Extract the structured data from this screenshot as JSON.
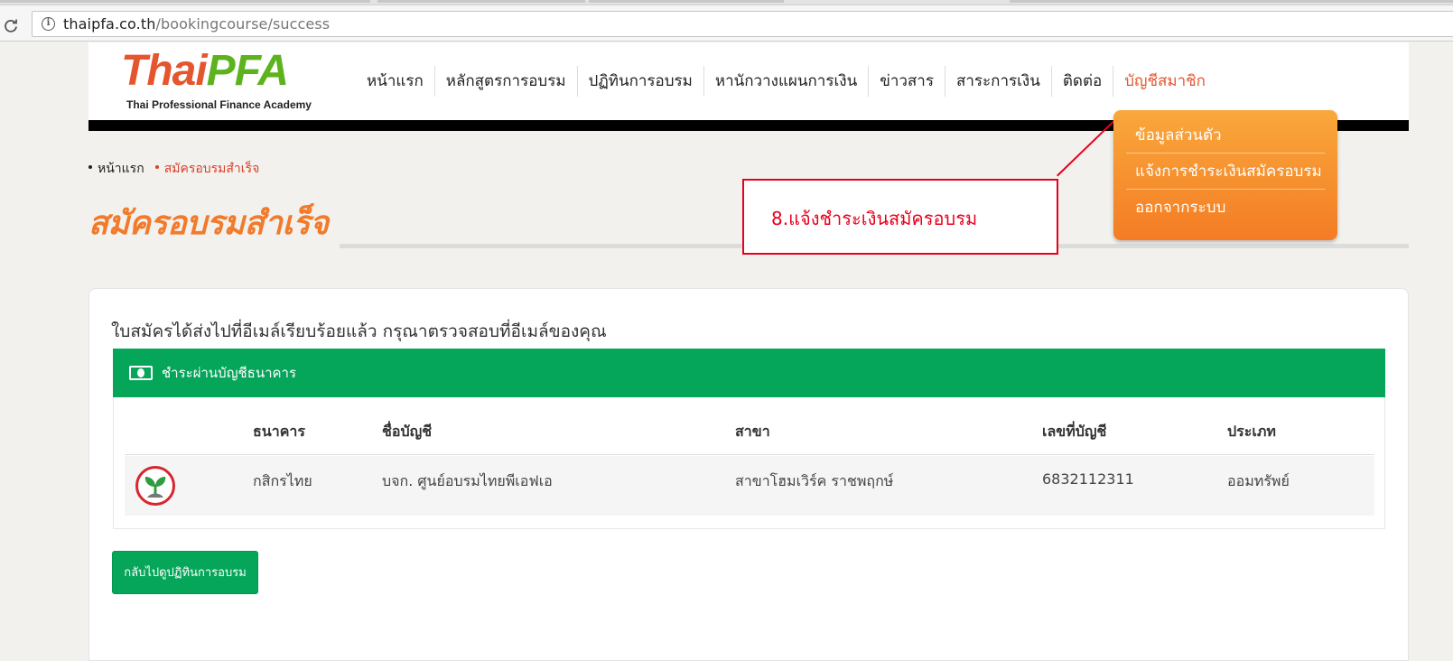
{
  "browser": {
    "url_host": "thaipfa.co.th",
    "url_path": "/bookingcourse/success"
  },
  "logo": {
    "name_part1": "Thai",
    "name_part2": "PFA",
    "tagline": "Thai Professional Finance Academy"
  },
  "nav": {
    "items": [
      "หน้าแรก",
      "หลักสูตรการอบรม",
      "ปฏิทินการอบรม",
      "หานักวางแผนการเงิน",
      "ข่าวสาร",
      "สาระการเงิน",
      "ติดต่อ"
    ],
    "active_item": "บัญชีสมาชิก"
  },
  "account_menu": {
    "items": [
      "ข้อมูลส่วนตัว",
      "แจ้งการชำระเงินสมัครอบรม",
      "ออกจากระบบ"
    ]
  },
  "breadcrumb": {
    "home": "หน้าแรก",
    "current": "สมัครอบรมสำเร็จ"
  },
  "page_title": "สมัครอบรมสำเร็จ",
  "annotation": {
    "text": "8.แจ้งชำระเงินสมัครอบรม",
    "color": "#e8001c"
  },
  "content": {
    "intro": "ใบสมัครได้ส่งไปที่อีเมล์เรียบร้อยแล้ว กรุณาตรวจสอบที่อีเมล์ของคุณ",
    "payment_header": "ชำระผ่านบัญชีธนาคาร",
    "table": {
      "columns": [
        "ธนาคาร",
        "ชื่อบัญชี",
        "สาขา",
        "เลขที่บัญชี",
        "ประเภท"
      ],
      "rows": [
        {
          "bank": "กสิกรไทย",
          "account_name": "บจก. ศูนย์อบรมไทยพีเอฟเอ",
          "branch": "สาขาโฮมเวิร์ค ราชพฤกษ์",
          "account_number": "6832112311",
          "type": "ออมทรัพย์"
        }
      ]
    },
    "back_button": "กลับไปดูปฏิทินการอบรม"
  },
  "colors": {
    "brand_orange": "#f27a2b",
    "brand_green": "#05a659",
    "menu_gradient_top": "#f9a83c",
    "menu_gradient_bottom": "#f47c24"
  }
}
